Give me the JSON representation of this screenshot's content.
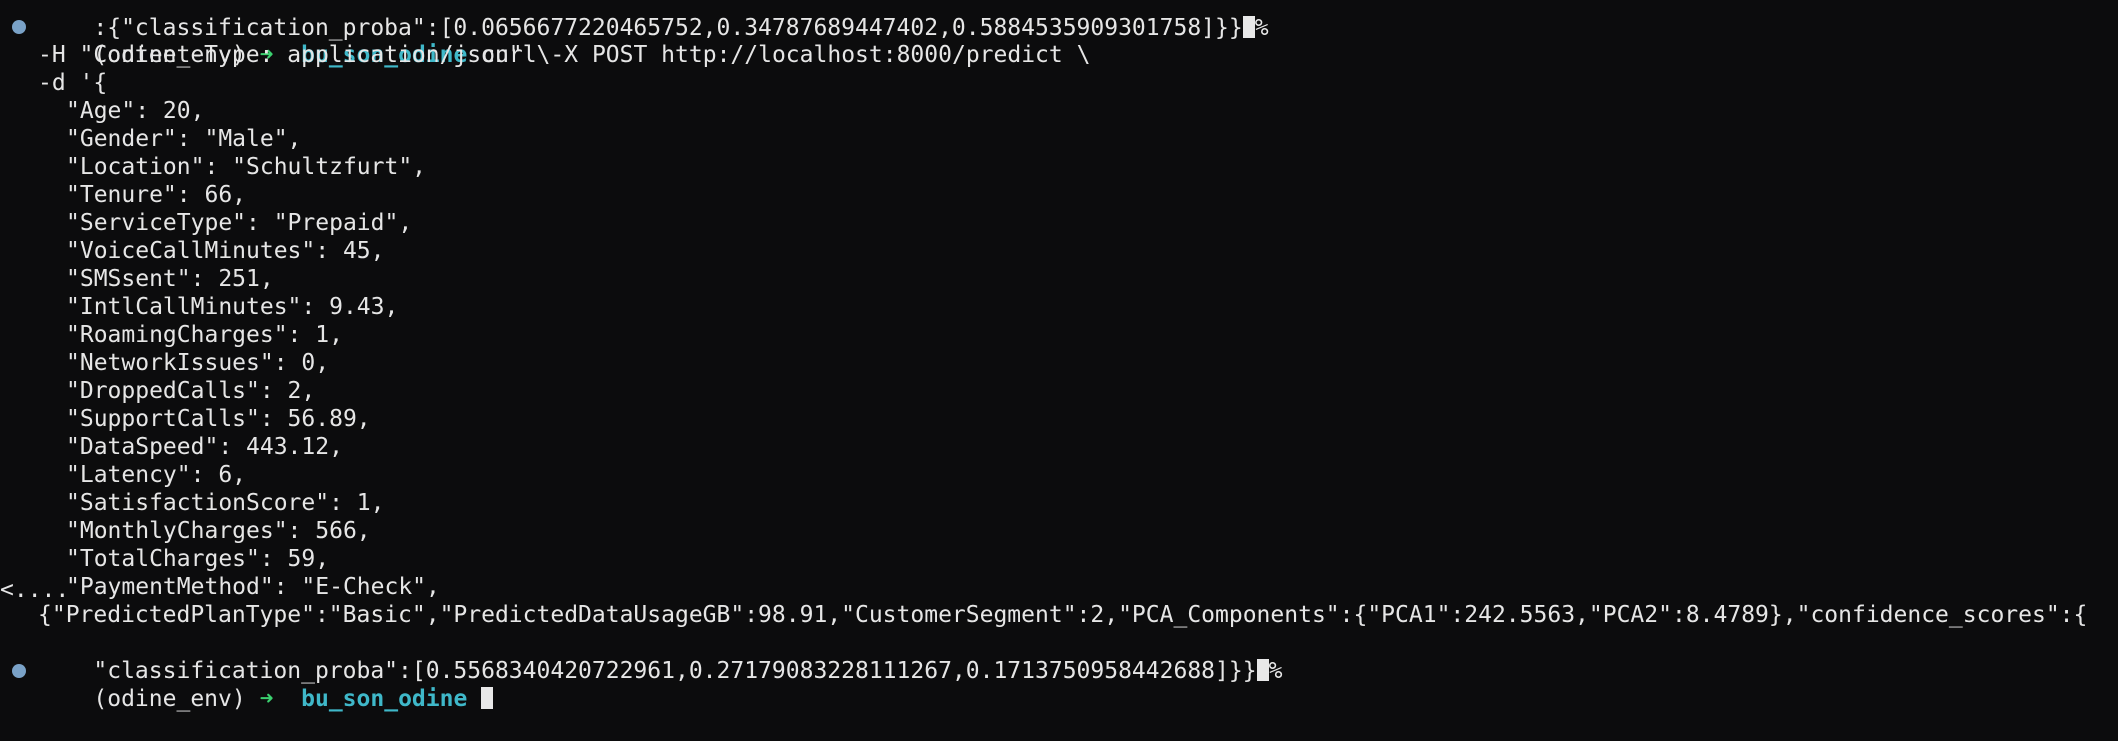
{
  "previous_output_tail": ":{\"classification_proba\":[0.0656677220465752,0.34787689447402,0.5884535909301758]}}",
  "prompt": {
    "env": "(odine_env)",
    "arrow": "➜",
    "dir": "bu_son_odine",
    "command": "curl -X POST http://localhost:8000/predict \\"
  },
  "continuation_lines": [
    "-H \"Content-Type: application/json\" \\",
    "-d '{"
  ],
  "body_lines": [
    "\"Age\": 20,",
    "\"Gender\": \"Male\",",
    "\"Location\": \"Schultzfurt\",",
    "\"Tenure\": 66,",
    "\"ServiceType\": \"Prepaid\",",
    "\"VoiceCallMinutes\": 45,",
    "\"SMSsent\": 251,",
    "\"IntlCallMinutes\": 9.43,",
    "\"RoamingCharges\": 1,",
    "\"NetworkIssues\": 0,",
    "\"DroppedCalls\": 2,",
    "\"SupportCalls\": 56.89,",
    "\"DataSpeed\": 443.12,",
    "\"Latency\": 6,",
    "\"SatisfactionScore\": 1,",
    "\"MonthlyCharges\": 566,",
    "\"TotalCharges\": 59,",
    "\"PaymentMethod\": \"E-Check\","
  ],
  "truncation_marker": "<....",
  "response_line_1": "{\"PredictedPlanType\":\"Basic\",\"PredictedDataUsageGB\":98.91,\"CustomerSegment\":2,\"PCA_Components\":{\"PCA1\":242.5563,\"PCA2\":8.4789},\"confidence_scores\":{",
  "response_line_2": "\"classification_proba\":[0.5568340420722961,0.27179083228111267,0.1713750958442688]}}",
  "end_marker": "%",
  "next_prompt": {
    "env": "(odine_env)",
    "arrow": "➜",
    "dir": "bu_son_odine"
  }
}
